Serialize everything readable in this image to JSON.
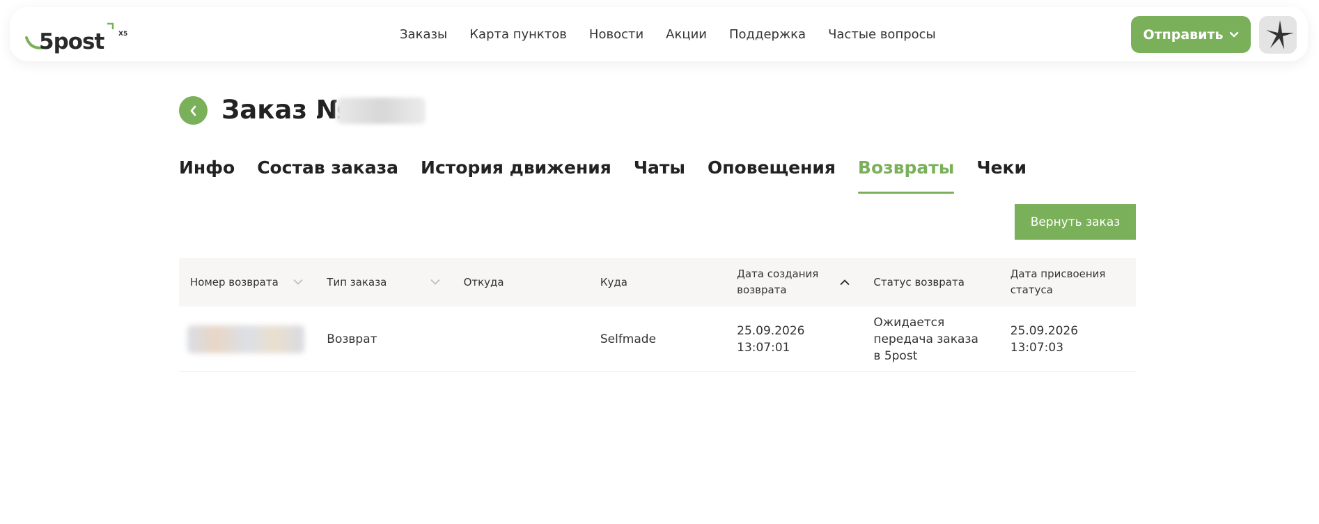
{
  "brand": {
    "logo_text": "5post",
    "logo_badge": "X5",
    "accent_color": "#7bb05a"
  },
  "nav": {
    "items": [
      "Заказы",
      "Карта пунктов",
      "Новости",
      "Акции",
      "Поддержка",
      "Частые вопросы"
    ]
  },
  "header": {
    "send_label": "Отправить",
    "send_icon": "chevron-down-icon",
    "avatar_icon": "user-avatar-icon"
  },
  "page": {
    "title": "Заказ №",
    "back_icon": "chevron-left-icon"
  },
  "tabs": {
    "items": [
      "Инфо",
      "Состав заказа",
      "История движения",
      "Чаты",
      "Оповещения",
      "Возвраты",
      "Чеки"
    ],
    "active": "Возвраты"
  },
  "actions": {
    "return_order_label": "Вернуть заказ"
  },
  "table": {
    "columns": [
      {
        "label": "Номер возврата",
        "sort": "chevron-down-icon"
      },
      {
        "label": "Тип заказа",
        "sort": "chevron-down-icon"
      },
      {
        "label": "Откуда",
        "sort": ""
      },
      {
        "label": "Куда",
        "sort": ""
      },
      {
        "label": "Дата создания возврата",
        "sort": "chevron-up-icon"
      },
      {
        "label": "Статус возврата",
        "sort": ""
      },
      {
        "label": "Дата присвоения статуса",
        "sort": ""
      }
    ],
    "rows": [
      {
        "return_number": "",
        "order_type": "Возврат",
        "from": "",
        "to": "Selfmade",
        "created_at": "25.09.2026 13:07:01",
        "status": "Ожидается передача заказа в 5post",
        "status_date": "25.09.2026 13:07:03"
      }
    ]
  }
}
